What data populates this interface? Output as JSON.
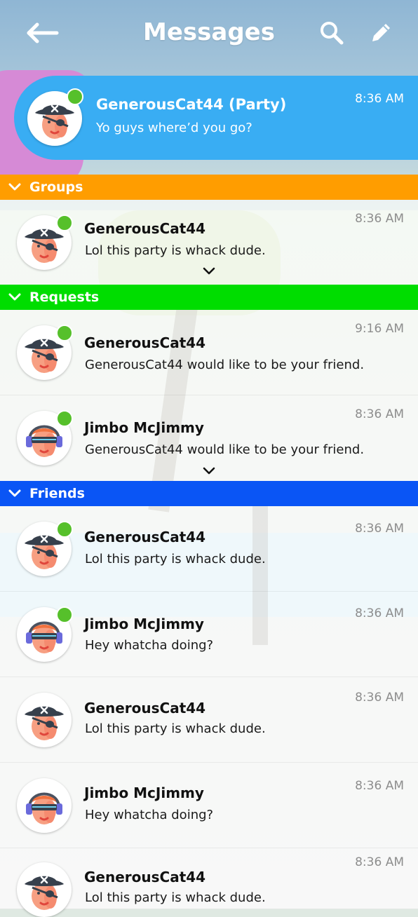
{
  "header": {
    "title": "Messages",
    "back_icon": "back-arrow-icon",
    "search_icon": "search-icon",
    "edit_icon": "pencil-icon"
  },
  "party": {
    "name": "GenerousCat44 (Party)",
    "message": "Yo guys where’d you go?",
    "time": "8:36 AM",
    "avatar": "pirate",
    "online": true
  },
  "sections": {
    "groups": {
      "label": "Groups",
      "color": "#ff9d00"
    },
    "requests": {
      "label": "Requests",
      "color": "#00dd00"
    },
    "friends": {
      "label": "Friends",
      "color": "#0a55f5"
    }
  },
  "groups": [
    {
      "name": "GenerousCat44",
      "message": "Lol this party is whack dude.",
      "time": "8:36 AM",
      "avatar": "pirate",
      "online": true
    }
  ],
  "requests": [
    {
      "name": "GenerousCat44",
      "message": "GenerousCat44 would like to be your friend.",
      "time": "9:16 AM",
      "avatar": "pirate",
      "online": true
    },
    {
      "name": "Jimbo McJimmy",
      "message": "GenerousCat44 would like to be your friend.",
      "time": "8:36 AM",
      "avatar": "headphones",
      "online": true
    }
  ],
  "friends": [
    {
      "name": "GenerousCat44",
      "message": "Lol this party is whack dude.",
      "time": "8:36 AM",
      "avatar": "pirate",
      "online": true
    },
    {
      "name": "Jimbo McJimmy",
      "message": "Hey whatcha doing?",
      "time": "8:36 AM",
      "avatar": "headphones",
      "online": true
    },
    {
      "name": "GenerousCat44",
      "message": "Lol this party is whack dude.",
      "time": "8:36 AM",
      "avatar": "pirate",
      "online": false
    },
    {
      "name": "Jimbo McJimmy",
      "message": "Hey whatcha doing?",
      "time": "8:36 AM",
      "avatar": "headphones",
      "online": false
    },
    {
      "name": "GenerousCat44",
      "message": "Lol this party is whack dude.",
      "time": "8:36 AM",
      "avatar": "pirate",
      "online": false
    }
  ],
  "colors": {
    "accent": "#39adf3",
    "online": "#56c02b"
  }
}
